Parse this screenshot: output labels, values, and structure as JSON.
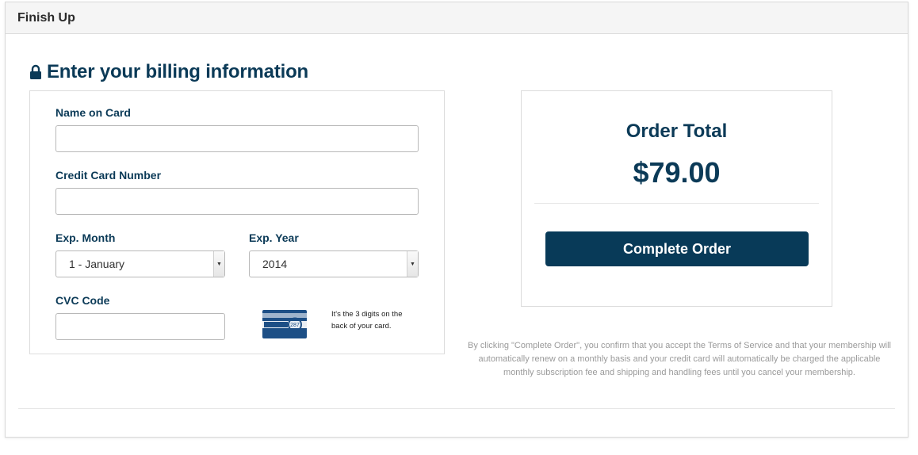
{
  "panel": {
    "title": "Finish Up"
  },
  "billing": {
    "heading": "Enter your billing information",
    "name_label": "Name on Card",
    "name_value": "",
    "card_label": "Credit Card Number",
    "card_value": "",
    "month_label": "Exp. Month",
    "month_value": "1 - January",
    "year_label": "Exp. Year",
    "year_value": "2014",
    "cvc_label": "CVC Code",
    "cvc_value": "",
    "cvc_hint": "It's the 3 digits on the back of your card.",
    "card_icon_text": "287"
  },
  "order": {
    "title": "Order Total",
    "amount": "$79.00",
    "button_label": "Complete Order"
  },
  "terms": "By clicking \"Complete Order\", you confirm that you accept the Terms of Service and that your membership will automatically renew on a monthly basis and your credit card will automatically be charged the applicable monthly subscription fee and shipping and handling fees until you cancel your membership.",
  "colors": {
    "accent": "#083a58",
    "text": "#0b3a57",
    "muted": "#9a9a9a"
  },
  "icons": {
    "lock": "lock-icon",
    "card": "credit-card-cvc-icon",
    "select_arrow": "caret-down-icon"
  }
}
